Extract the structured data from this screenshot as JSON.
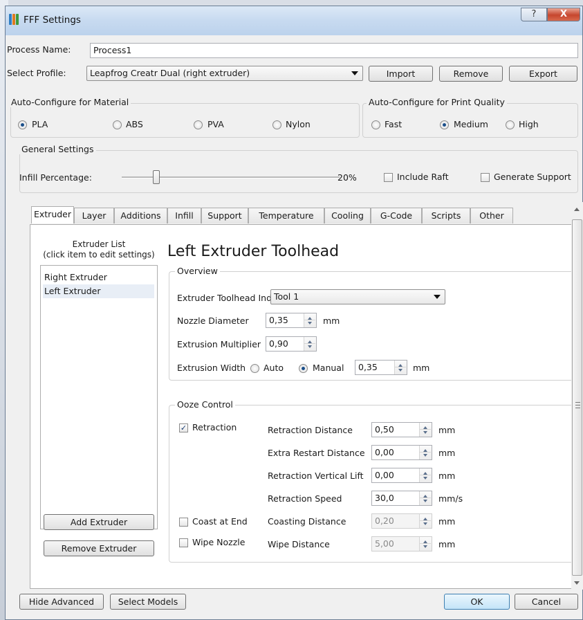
{
  "window": {
    "title": "FFF Settings",
    "help_label": "?",
    "close_label": "X"
  },
  "process": {
    "label": "Process Name:",
    "value": "Process1"
  },
  "profile": {
    "label": "Select Profile:",
    "value": "Leapfrog Creatr Dual (right extruder)",
    "import_label": "Import",
    "remove_label": "Remove",
    "export_label": "Export"
  },
  "material": {
    "title": "Auto-Configure for Material",
    "options": [
      "PLA",
      "ABS",
      "PVA",
      "Nylon"
    ],
    "selected": "PLA"
  },
  "quality": {
    "title": "Auto-Configure for Print Quality",
    "options": [
      "Fast",
      "Medium",
      "High"
    ],
    "selected": "Medium"
  },
  "general": {
    "title": "General Settings",
    "infill_label": "Infill Percentage:",
    "infill_value_text": "20%",
    "infill_value": 0.2,
    "include_raft_label": "Include Raft",
    "generate_support_label": "Generate Support"
  },
  "tabs": [
    "Extruder",
    "Layer",
    "Additions",
    "Infill",
    "Support",
    "Temperature",
    "Cooling",
    "G-Code",
    "Scripts",
    "Other"
  ],
  "active_tab": "Extruder",
  "extruder_list": {
    "title_line1": "Extruder List",
    "title_line2": "(click item to edit settings)",
    "items": [
      "Right Extruder",
      "Left Extruder"
    ],
    "selected": "Left Extruder",
    "add_label": "Add Extruder",
    "remove_label": "Remove Extruder"
  },
  "editor": {
    "heading": "Left Extruder Toolhead",
    "overview": {
      "title": "Overview",
      "toolhead_index_label": "Extruder Toolhead Index",
      "toolhead_index_value": "Tool 1",
      "nozzle_label": "Nozzle Diameter",
      "nozzle_value": "0,35",
      "nozzle_unit": "mm",
      "multiplier_label": "Extrusion Multiplier",
      "multiplier_value": "0,90",
      "width_label": "Extrusion Width",
      "width_auto": "Auto",
      "width_manual": "Manual",
      "width_mode": "Manual",
      "width_value": "0,35",
      "width_unit": "mm"
    },
    "ooze": {
      "title": "Ooze Control",
      "retraction_label": "Retraction",
      "retraction_checked": true,
      "coast_label": "Coast at End",
      "coast_checked": false,
      "wipe_label": "Wipe Nozzle",
      "wipe_checked": false,
      "rows": [
        {
          "label": "Retraction Distance",
          "value": "0,50",
          "unit": "mm",
          "enabled": true
        },
        {
          "label": "Extra Restart Distance",
          "value": "0,00",
          "unit": "mm",
          "enabled": true
        },
        {
          "label": "Retraction Vertical Lift",
          "value": "0,00",
          "unit": "mm",
          "enabled": true
        },
        {
          "label": "Retraction Speed",
          "value": "30,0",
          "unit": "mm/s",
          "enabled": true
        },
        {
          "label": "Coasting Distance",
          "value": "0,20",
          "unit": "mm",
          "enabled": false
        },
        {
          "label": "Wipe Distance",
          "value": "5,00",
          "unit": "mm",
          "enabled": false
        }
      ]
    }
  },
  "footer": {
    "hide_advanced_label": "Hide Advanced",
    "select_models_label": "Select Models",
    "ok_label": "OK",
    "cancel_label": "Cancel"
  },
  "colors": {
    "accent": "#1b4f8a",
    "titlebar": "#c7daf0",
    "close": "#c6462e"
  }
}
